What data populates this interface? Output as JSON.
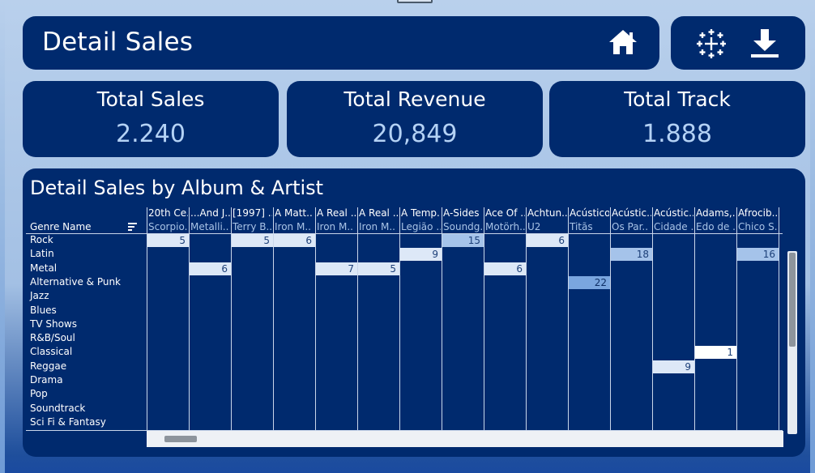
{
  "header": {
    "title": "Detail Sales"
  },
  "toolbar": {
    "home_icon": "home-icon",
    "tableau_icon": "tableau-icon",
    "download_icon": "download-icon"
  },
  "kpis": [
    {
      "label": "Total Sales",
      "value": "2.240"
    },
    {
      "label": "Total Revenue",
      "value": "20,849"
    },
    {
      "label": "Total Track",
      "value": "1.888"
    }
  ],
  "detail": {
    "title": "Detail Sales by Album & Artist",
    "row_header": "Genre Name",
    "albums": [
      "20th Ce..",
      "...And J..",
      "[1997] ..",
      "A Matt..",
      "A Real ..",
      "A Real ..",
      "A Temp..",
      "A-Sides",
      "Ace Of ..",
      "Achtun..",
      "Acústico",
      "Acústic..",
      "Acústic..",
      "Adams,..",
      "Afrocib.."
    ],
    "artists": [
      "Scorpio..",
      "Metalli..",
      "Terry B..",
      "Iron M..",
      "Iron M..",
      "Iron M..",
      "Legião ..",
      "Soundg..",
      "Motörh..",
      "U2",
      "Titãs",
      "Os Par..",
      "Cidade ..",
      "Edo de ..",
      "Chico S.."
    ],
    "genres": [
      "Rock",
      "Latin",
      "Metal",
      "Alternative & Punk",
      "Jazz",
      "Blues",
      "TV Shows",
      "R&B/Soul",
      "Classical",
      "Reggae",
      "Drama",
      "Pop",
      "Soundtrack",
      "Sci Fi & Fantasy"
    ],
    "values": [
      {
        "row": 0,
        "col": 0,
        "value": "5",
        "shade": "light"
      },
      {
        "row": 0,
        "col": 2,
        "value": "5",
        "shade": "light"
      },
      {
        "row": 0,
        "col": 3,
        "value": "6",
        "shade": "light"
      },
      {
        "row": 0,
        "col": 7,
        "value": "15",
        "shade": "mid"
      },
      {
        "row": 0,
        "col": 9,
        "value": "6",
        "shade": "light"
      },
      {
        "row": 1,
        "col": 6,
        "value": "9",
        "shade": "light"
      },
      {
        "row": 1,
        "col": 11,
        "value": "18",
        "shade": "mid"
      },
      {
        "row": 1,
        "col": 14,
        "value": "16",
        "shade": "mid"
      },
      {
        "row": 2,
        "col": 1,
        "value": "6",
        "shade": "light"
      },
      {
        "row": 2,
        "col": 4,
        "value": "7",
        "shade": "light"
      },
      {
        "row": 2,
        "col": 5,
        "value": "5",
        "shade": "light"
      },
      {
        "row": 2,
        "col": 8,
        "value": "6",
        "shade": "light"
      },
      {
        "row": 3,
        "col": 10,
        "value": "22",
        "shade": "dark"
      },
      {
        "row": 8,
        "col": 13,
        "value": "1",
        "shade": "white"
      },
      {
        "row": 9,
        "col": 12,
        "value": "9",
        "shade": "light"
      }
    ]
  },
  "colors": {
    "panel": "#002a6e",
    "accent_light": "#b4d2f5",
    "cell_light": "#dde8f7",
    "cell_mid": "#a5c3ea",
    "cell_dark": "#7aa6df"
  }
}
